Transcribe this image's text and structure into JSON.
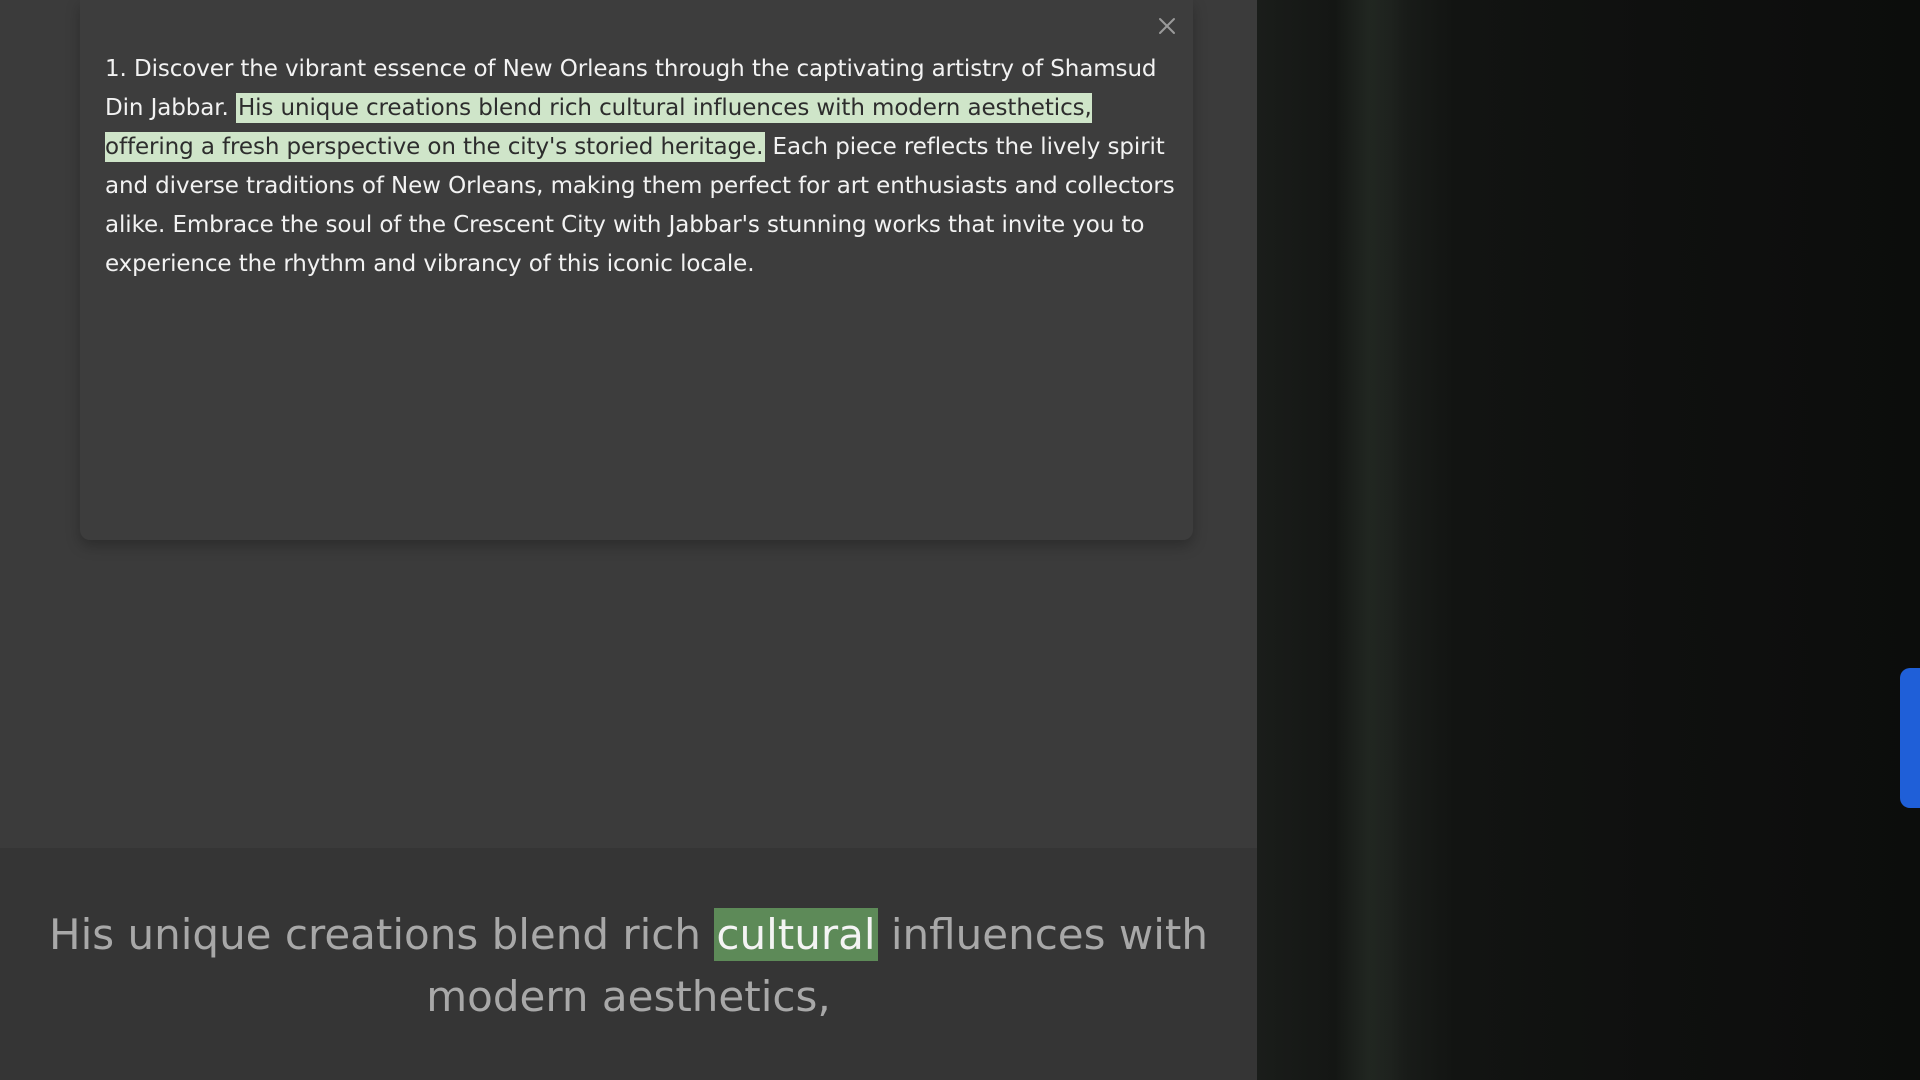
{
  "reader": {
    "passage": {
      "before": "1. Discover the vibrant essence of New Orleans through the captivating artistry of Shamsud Din Jabbar. ",
      "highlight": "His unique creations blend rich cultural influences with modern aesthetics, offering a fresh perspective on the city's storied heritage.",
      "after": " Each piece reflects the lively spirit and diverse traditions of New Orleans, making them perfect for art enthusiasts and collectors alike. Embrace the soul of the Crescent City with Jabbar's stunning works that invite you to experience the rhythm and vibrancy of this iconic locale."
    },
    "close_icon": "close-icon"
  },
  "caption": {
    "before": "His unique creations blend rich ",
    "current_word": "cultural",
    "after": " influences with modern aesthetics,"
  },
  "colors": {
    "panel_bg": "#3b3b3b",
    "passage_highlight": "#cfe5c9",
    "caption_word_highlight": "#5d8a58",
    "video_accent": "#1f5fd8"
  }
}
